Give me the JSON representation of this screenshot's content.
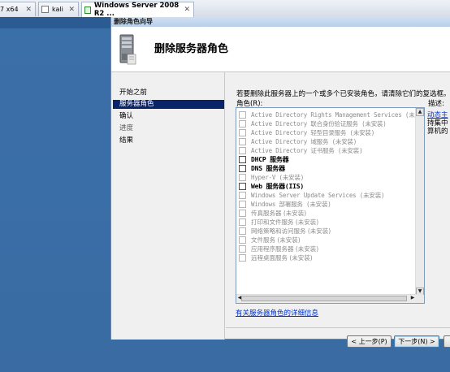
{
  "tabs": [
    {
      "label": "7 x64",
      "active": false
    },
    {
      "label": "kali",
      "active": false
    },
    {
      "label": "Windows Server 2008 R2 ...",
      "active": true
    }
  ],
  "window": {
    "title": "删除角色向导"
  },
  "banner": {
    "title": "删除服务器角色"
  },
  "nav": {
    "items": [
      {
        "label": "开始之前",
        "selected": false,
        "enabled": true
      },
      {
        "label": "服务器角色",
        "selected": true,
        "enabled": true
      },
      {
        "label": "确认",
        "selected": false,
        "enabled": true
      },
      {
        "label": "进度",
        "selected": false,
        "enabled": false
      },
      {
        "label": "结果",
        "selected": false,
        "enabled": true
      }
    ]
  },
  "main": {
    "instruction": "若要删除此服务器上的一个或多个已安装角色，请清除它们的复选框。",
    "roles_label": "角色(R):",
    "description_label": "描述:",
    "description_link": "动态主",
    "description_lines": [
      "持集中",
      "算机的"
    ],
    "roles": [
      {
        "label": "Active Directory Rights Management Services  (未安装)",
        "enabled": false,
        "mono": true
      },
      {
        "label": "Active Directory 联合身份验证服务  (未安装)",
        "enabled": false,
        "mono": true
      },
      {
        "label": "Active Directory 轻型目录服务  (未安装)",
        "enabled": false,
        "mono": true
      },
      {
        "label": "Active Directory 域服务  (未安装)",
        "enabled": false,
        "mono": true
      },
      {
        "label": "Active Directory 证书服务  (未安装)",
        "enabled": false,
        "mono": true
      },
      {
        "label": "DHCP 服务器",
        "enabled": true,
        "mono": true
      },
      {
        "label": "DNS 服务器",
        "enabled": true,
        "mono": true
      },
      {
        "label": "Hyper-V  (未安装)",
        "enabled": false,
        "mono": true
      },
      {
        "label": "Web 服务器(IIS)",
        "enabled": true,
        "mono": true
      },
      {
        "label": "Windows Server Update Services  (未安装)",
        "enabled": false,
        "mono": true
      },
      {
        "label": "Windows 部署服务  (未安装)",
        "enabled": false,
        "mono": true
      },
      {
        "label": "传真服务器  (未安装)",
        "enabled": false,
        "mono": false
      },
      {
        "label": "打印和文件服务  (未安装)",
        "enabled": false,
        "mono": false
      },
      {
        "label": "网络策略和访问服务  (未安装)",
        "enabled": false,
        "mono": false
      },
      {
        "label": "文件服务  (未安装)",
        "enabled": false,
        "mono": false
      },
      {
        "label": "应用程序服务器  (未安装)",
        "enabled": false,
        "mono": false
      },
      {
        "label": "远程桌面服务  (未安装)",
        "enabled": false,
        "mono": false
      }
    ],
    "details_link": "有关服务器角色的详细信息"
  },
  "buttons": {
    "back": "< 上一步(P)",
    "next": "下一步(N) >"
  },
  "scroll": {
    "left_arrow": "◀",
    "right_arrow": "▶",
    "up_arrow": "▲",
    "down_arrow": "▼"
  }
}
